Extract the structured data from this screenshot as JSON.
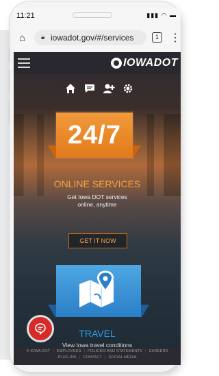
{
  "status_bar": {
    "time": "11:21"
  },
  "browser": {
    "url": "iowadot.gov/#/services",
    "tab_count": "1"
  },
  "site": {
    "logo_text": "IOWADOT",
    "quick_icons": [
      "home-icon",
      "feedback-icon",
      "account-add-icon",
      "settings-icon"
    ],
    "online_services": {
      "badge": "24/7",
      "title": "ONLINE SERVICES",
      "desc_line1": "Get Iowa DOT services",
      "desc_line2": "online, anytime",
      "button": "GET IT NOW"
    },
    "travel": {
      "title": "TRAVEL",
      "desc": "View Iowa travel conditions"
    },
    "footer": {
      "row1": [
        "© IOWA DOT",
        "EMPLOYEES",
        "POLICIES AND STATEMENTS",
        "CAREERS"
      ],
      "row2": [
        "PLUG-INS",
        "CONTACT",
        "SOCIAL MEDIA"
      ]
    }
  },
  "colors": {
    "accent_orange": "#e27a1c",
    "travel_blue": "#2a7fc8",
    "chat_red": "#d62b2b"
  }
}
